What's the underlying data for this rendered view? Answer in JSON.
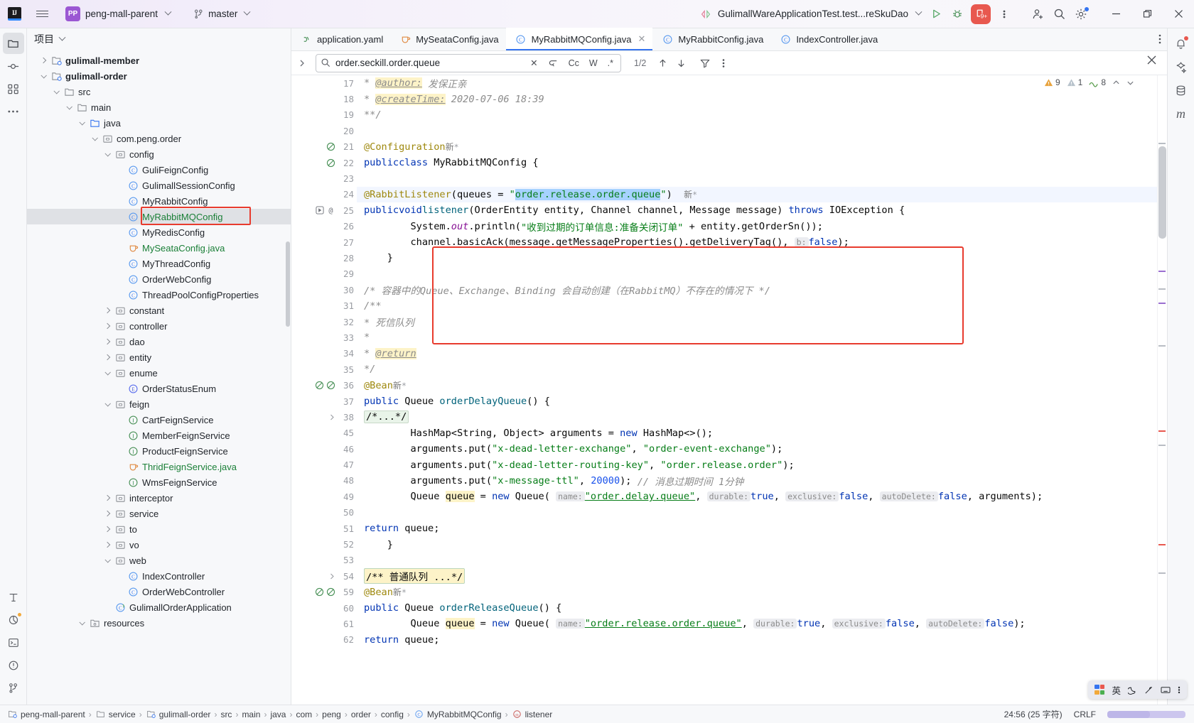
{
  "titlebar": {
    "logo": "ij-logo",
    "project_badge": "PP",
    "project_name": "peng-mall-parent",
    "branch_icon": "git-branch-icon",
    "branch": "master",
    "run_config": "GulimallWareApplicationTest.test...reSkuDao",
    "run_icon": "run-icon",
    "debug_icon": "debug-icon",
    "services_badge": "9+",
    "more_icon": "more-vertical-icon",
    "account_icon": "account-add-icon",
    "search_icon": "search-icon",
    "settings_icon": "gear-icon",
    "minimize": "minimize-icon",
    "maximize": "maximize-icon",
    "close": "close-icon"
  },
  "left_rail": {
    "items": [
      {
        "name": "project-tool-window",
        "icon": "folder-icon",
        "active": true
      },
      {
        "name": "commit-tool-window",
        "icon": "commit-icon",
        "active": false
      },
      {
        "name": "structure-tool-window",
        "icon": "structure-icon",
        "active": false
      },
      {
        "name": "more-tool-windows",
        "icon": "ellipsis-icon",
        "active": false
      }
    ],
    "bottom_items": [
      {
        "name": "typography-tool",
        "icon": "font-icon"
      },
      {
        "name": "coverage-tool",
        "icon": "coverage-icon"
      },
      {
        "name": "terminal-tool",
        "icon": "terminal-icon"
      },
      {
        "name": "problems-tool",
        "icon": "warning-circle-icon"
      },
      {
        "name": "version-control-tool",
        "icon": "git-icon"
      }
    ]
  },
  "right_rail": {
    "items": [
      {
        "name": "notifications",
        "icon": "bell-icon"
      },
      {
        "name": "ai-assistant",
        "icon": "ai-icon"
      },
      {
        "name": "database",
        "icon": "database-icon"
      },
      {
        "name": "maven",
        "icon": "maven-m-icon"
      }
    ]
  },
  "project_panel": {
    "title": "项目",
    "tree": [
      {
        "depth": 2,
        "label": "gulimall-member",
        "icon": "module-icon",
        "twisty": "right",
        "bold": true,
        "color": "#1f2329"
      },
      {
        "depth": 2,
        "label": "gulimall-order",
        "icon": "module-icon",
        "twisty": "down",
        "bold": true,
        "color": "#1f2329"
      },
      {
        "depth": 3,
        "label": "src",
        "icon": "folder-icon",
        "twisty": "down",
        "bold": false,
        "color": "#1f2329"
      },
      {
        "depth": 4,
        "label": "main",
        "icon": "folder-icon",
        "twisty": "down",
        "bold": false,
        "color": "#1f2329"
      },
      {
        "depth": 5,
        "label": "java",
        "icon": "folder-blue-icon",
        "twisty": "down",
        "bold": false,
        "color": "#1f2329"
      },
      {
        "depth": 6,
        "label": "com.peng.order",
        "icon": "package-icon",
        "twisty": "down",
        "bold": false,
        "color": "#1f2329"
      },
      {
        "depth": 7,
        "label": "config",
        "icon": "package-icon",
        "twisty": "down",
        "bold": false,
        "color": "#1f2329"
      },
      {
        "depth": 8,
        "label": "GuliFeignConfig",
        "icon": "class-icon",
        "twisty": "",
        "bold": false,
        "color": "#1f2329"
      },
      {
        "depth": 8,
        "label": "GulimallSessionConfig",
        "icon": "class-icon",
        "twisty": "",
        "bold": false,
        "color": "#1f2329"
      },
      {
        "depth": 8,
        "label": "MyRabbitConfig",
        "icon": "class-icon",
        "twisty": "",
        "bold": false,
        "color": "#1f2329"
      },
      {
        "depth": 8,
        "label": "MyRabbitMQConfig",
        "icon": "class-icon",
        "twisty": "",
        "bold": false,
        "color": "#1a7f37",
        "selected": true,
        "annotated": true
      },
      {
        "depth": 8,
        "label": "MyRedisConfig",
        "icon": "class-icon",
        "twisty": "",
        "bold": false,
        "color": "#1f2329"
      },
      {
        "depth": 8,
        "label": "MySeataConfig.java",
        "icon": "java-file-icon",
        "twisty": "",
        "bold": false,
        "color": "#1a7f37"
      },
      {
        "depth": 8,
        "label": "MyThreadConfig",
        "icon": "class-icon",
        "twisty": "",
        "bold": false,
        "color": "#1f2329"
      },
      {
        "depth": 8,
        "label": "OrderWebConfig",
        "icon": "class-icon",
        "twisty": "",
        "bold": false,
        "color": "#1f2329"
      },
      {
        "depth": 8,
        "label": "ThreadPoolConfigProperties",
        "icon": "class-icon",
        "twisty": "",
        "bold": false,
        "color": "#1f2329"
      },
      {
        "depth": 7,
        "label": "constant",
        "icon": "package-icon",
        "twisty": "right",
        "bold": false,
        "color": "#1f2329"
      },
      {
        "depth": 7,
        "label": "controller",
        "icon": "package-icon",
        "twisty": "right",
        "bold": false,
        "color": "#1f2329"
      },
      {
        "depth": 7,
        "label": "dao",
        "icon": "package-icon",
        "twisty": "right",
        "bold": false,
        "color": "#1f2329"
      },
      {
        "depth": 7,
        "label": "entity",
        "icon": "package-icon",
        "twisty": "right",
        "bold": false,
        "color": "#1f2329"
      },
      {
        "depth": 7,
        "label": "enume",
        "icon": "package-icon",
        "twisty": "down",
        "bold": false,
        "color": "#1f2329"
      },
      {
        "depth": 8,
        "label": "OrderStatusEnum",
        "icon": "enum-icon",
        "twisty": "",
        "bold": false,
        "color": "#1f2329"
      },
      {
        "depth": 7,
        "label": "feign",
        "icon": "package-icon",
        "twisty": "down",
        "bold": false,
        "color": "#1f2329"
      },
      {
        "depth": 8,
        "label": "CartFeignService",
        "icon": "interface-icon",
        "twisty": "",
        "bold": false,
        "color": "#1f2329"
      },
      {
        "depth": 8,
        "label": "MemberFeignService",
        "icon": "interface-icon",
        "twisty": "",
        "bold": false,
        "color": "#1f2329"
      },
      {
        "depth": 8,
        "label": "ProductFeignService",
        "icon": "interface-icon",
        "twisty": "",
        "bold": false,
        "color": "#1f2329"
      },
      {
        "depth": 8,
        "label": "ThridFeignService.java",
        "icon": "java-file-icon",
        "twisty": "",
        "bold": false,
        "color": "#1a7f37"
      },
      {
        "depth": 8,
        "label": "WmsFeignService",
        "icon": "interface-icon",
        "twisty": "",
        "bold": false,
        "color": "#1f2329"
      },
      {
        "depth": 7,
        "label": "interceptor",
        "icon": "package-icon",
        "twisty": "right",
        "bold": false,
        "color": "#1f2329"
      },
      {
        "depth": 7,
        "label": "service",
        "icon": "package-icon",
        "twisty": "right",
        "bold": false,
        "color": "#1f2329"
      },
      {
        "depth": 7,
        "label": "to",
        "icon": "package-icon",
        "twisty": "right",
        "bold": false,
        "color": "#1f2329"
      },
      {
        "depth": 7,
        "label": "vo",
        "icon": "package-icon",
        "twisty": "right",
        "bold": false,
        "color": "#1f2329"
      },
      {
        "depth": 7,
        "label": "web",
        "icon": "package-icon",
        "twisty": "down",
        "bold": false,
        "color": "#1f2329"
      },
      {
        "depth": 8,
        "label": "IndexController",
        "icon": "class-icon",
        "twisty": "",
        "bold": false,
        "color": "#1f2329"
      },
      {
        "depth": 8,
        "label": "OrderWebController",
        "icon": "class-icon",
        "twisty": "",
        "bold": false,
        "color": "#1f2329"
      },
      {
        "depth": 7,
        "label": "GulimallOrderApplication",
        "icon": "spring-class-icon",
        "twisty": "",
        "bold": false,
        "color": "#1f2329"
      },
      {
        "depth": 5,
        "label": "resources",
        "icon": "resources-folder-icon",
        "twisty": "down",
        "bold": false,
        "color": "#1f2329"
      }
    ]
  },
  "tabs": [
    {
      "label": "application.yaml",
      "icon": "yaml-icon",
      "active": false,
      "closable": false
    },
    {
      "label": "MySeataConfig.java",
      "icon": "java-file-icon",
      "active": false,
      "closable": false
    },
    {
      "label": "MyRabbitMQConfig.java",
      "icon": "class-icon",
      "active": true,
      "closable": true
    },
    {
      "label": "MyRabbitConfig.java",
      "icon": "class-icon",
      "active": false,
      "closable": false
    },
    {
      "label": "IndexController.java",
      "icon": "class-icon",
      "active": false,
      "closable": false
    }
  ],
  "find": {
    "value": "order.seckill.order.queue",
    "placeholder": "Search",
    "clear_label": "✕",
    "regex_toggle": ".*",
    "case_toggle": "Cc",
    "words_toggle": "W",
    "preserve_case_icon": "preserve-case-icon",
    "counter": "1/2",
    "prev_icon": "arrow-up-icon",
    "next_icon": "arrow-down-icon",
    "filter_icon": "filter-icon",
    "more_icon": "more-vertical-icon",
    "close_icon": "close-icon"
  },
  "inspections": {
    "warnings": "9",
    "weak_warnings": "1",
    "typos": "8",
    "warning_color": "#e8a33d",
    "weak_color": "#a9b7c6",
    "typo_color": "#5b9e4f"
  },
  "code": {
    "lines": [
      {
        "num": "17",
        "marks": [],
        "html": "  <span class='cmt'>* </span><span class='cmt yl-hl ul'>@author:</span><span class='cmt'> 发保正亲</span>"
      },
      {
        "num": "18",
        "marks": [],
        "html": "  <span class='cmt'>* </span><span class='cmt yl-hl ul'>@createTime:</span><span class='cmt'> 2020-07-06 18:39</span>"
      },
      {
        "num": "19",
        "marks": [],
        "html": "  <span class='cmt'>**/</span>"
      },
      {
        "num": "20",
        "marks": [],
        "html": ""
      },
      {
        "num": "21",
        "marks": [
          "bean"
        ],
        "html": "<span class='anno'>@Configuration</span>  <span class='newtag'>新</span><span class='newmark'>*</span>"
      },
      {
        "num": "22",
        "marks": [
          "bean2"
        ],
        "html": "<span class='kw'>public</span> <span class='kw'>class</span> MyRabbitMQConfig {"
      },
      {
        "num": "23",
        "marks": [],
        "html": ""
      },
      {
        "num": "24",
        "marks": [],
        "hl": true,
        "html": "    <span class='anno'>@RabbitListener</span>(queues = <span class='str'>\"</span><span class='str sel-hl'>order.release.order.queue</span><span class='str'>\"</span>)  <span class='newtag'>新</span><span class='newmark'>*</span>"
      },
      {
        "num": "25",
        "marks": [
          "run",
          "at"
        ],
        "html": "    <span class='kw'>public</span> <span class='kw'>void</span> <span class='meth'>listener</span>(OrderEntity entity, Channel channel, Message message) <span class='kw'>throws</span> IOException {"
      },
      {
        "num": "26",
        "marks": [],
        "html": "        System.<span class='fld stat'>out</span>.println(<span class='str'>\"收到过期的订单信息:准备关闭订单\"</span> + entity.getOrderSn());"
      },
      {
        "num": "27",
        "marks": [],
        "html": "        channel.basicAck(message.getMessageProperties().getDeliveryTag(), <span class='hint'>b:</span> <span class='kw'>false</span>);"
      },
      {
        "num": "28",
        "marks": [],
        "html": "    }"
      },
      {
        "num": "29",
        "marks": [],
        "html": ""
      },
      {
        "num": "30",
        "marks": [],
        "html": "    <span class='cmt'>/* 容器中的Queue、Exchange、Binding 会自动创建（在RabbitMQ）不存在的情况下 */</span>"
      },
      {
        "num": "31",
        "marks": [],
        "html": "    <span class='cmt'>/**</span>"
      },
      {
        "num": "32",
        "marks": [],
        "html": "     <span class='cmt'>* 死信队列</span>"
      },
      {
        "num": "33",
        "marks": [],
        "html": "     <span class='cmt'>*</span>"
      },
      {
        "num": "34",
        "marks": [],
        "html": "     <span class='cmt'>* </span><span class='cmt yl-hl ul'>@return</span>"
      },
      {
        "num": "35",
        "marks": [],
        "html": "     <span class='cmt'>*/</span>"
      },
      {
        "num": "36",
        "marks": [
          "bean",
          "bean2"
        ],
        "html": "    <span class='anno'>@Bean</span>  <span class='newtag'>新</span><span class='newmark'>*</span>"
      },
      {
        "num": "37",
        "marks": [],
        "html": "    <span class='kw'>public</span> Queue <span class='meth'>orderDelayQueue</span>() {"
      },
      {
        "num": "38",
        "marks": [
          "fold"
        ],
        "html": "        <span class='fold'>/*...*/</span>"
      },
      {
        "num": "45",
        "marks": [],
        "html": "        HashMap&lt;String, Object&gt; arguments = <span class='kw'>new</span> HashMap&lt;&gt;();"
      },
      {
        "num": "46",
        "marks": [],
        "html": "        arguments.put(<span class='str'>\"x-dead-letter-exchange\"</span>, <span class='str'>\"order-event-exchange\"</span>);"
      },
      {
        "num": "47",
        "marks": [],
        "html": "        arguments.put(<span class='str'>\"x-dead-letter-routing-key\"</span>, <span class='str'>\"order.release.order\"</span>);"
      },
      {
        "num": "48",
        "marks": [],
        "html": "        arguments.put(<span class='str'>\"x-message-ttl\"</span>, <span class='num'>20000</span>); <span class='cmt'>// 消息过期时间 1分钟</span>"
      },
      {
        "num": "49",
        "marks": [],
        "html": "        Queue <span class='yl-hl'>queue</span> = <span class='kw'>new</span> Queue( <span class='hint'>name:</span> <span class='str ul'>\"order.delay.queue\"</span>, <span class='hint'>durable:</span> <span class='kw'>true</span>, <span class='hint'>exclusive:</span> <span class='kw'>false</span>, <span class='hint'>autoDelete:</span> <span class='kw'>false</span>, arguments);"
      },
      {
        "num": "50",
        "marks": [],
        "html": ""
      },
      {
        "num": "51",
        "marks": [],
        "html": "        <span class='kw'>return</span> queue;"
      },
      {
        "num": "52",
        "marks": [],
        "html": "    }"
      },
      {
        "num": "53",
        "marks": [],
        "html": ""
      },
      {
        "num": "54",
        "marks": [
          "fold"
        ],
        "html": "    <span class='foldyl'>/** 普通队列 ...*/</span>"
      },
      {
        "num": "59",
        "marks": [
          "bean",
          "bean2"
        ],
        "html": "    <span class='anno'>@Bean</span>  <span class='newtag'>新</span><span class='newmark'>*</span>"
      },
      {
        "num": "60",
        "marks": [],
        "html": "    <span class='kw'>public</span> Queue <span class='meth'>orderReleaseQueue</span>() {"
      },
      {
        "num": "61",
        "marks": [],
        "html": "        Queue <span class='yl-hl'>queue</span> = <span class='kw'>new</span> Queue( <span class='hint'>name:</span> <span class='str ul'>\"order.release.order.queue\"</span>, <span class='hint'>durable:</span> <span class='kw'>true</span>, <span class='hint'>exclusive:</span> <span class='kw'>false</span>, <span class='hint'>autoDelete:</span> <span class='kw'>false</span>);"
      },
      {
        "num": "62",
        "marks": [],
        "html": "        <span class='kw'>return</span> queue;"
      }
    ]
  },
  "statusbar": {
    "breadcrumbs": [
      {
        "label": "peng-mall-parent",
        "icon": "module-icon"
      },
      {
        "label": "service",
        "icon": "folder-icon"
      },
      {
        "label": "gulimall-order",
        "icon": "module-icon"
      },
      {
        "label": "src",
        "icon": ""
      },
      {
        "label": "main",
        "icon": ""
      },
      {
        "label": "java",
        "icon": ""
      },
      {
        "label": "com",
        "icon": ""
      },
      {
        "label": "peng",
        "icon": ""
      },
      {
        "label": "order",
        "icon": ""
      },
      {
        "label": "config",
        "icon": ""
      },
      {
        "label": "MyRabbitMQConfig",
        "icon": "class-icon"
      },
      {
        "label": "listener",
        "icon": "method-icon"
      }
    ],
    "caret": "24:56 (25 字符)",
    "line_sep": "CRLF"
  },
  "ime_widget": {
    "lang": "英",
    "moon_icon": "moon-icon",
    "tools_icon": "tools-icon",
    "keyboard_icon": "keyboard-icon",
    "more_icon": "more-icon"
  },
  "colors": {
    "accent": "#3574f0",
    "red_annotation": "#e83b2e",
    "run_green": "#59a869",
    "string_green": "#067d17",
    "keyword_blue": "#0033b3"
  }
}
